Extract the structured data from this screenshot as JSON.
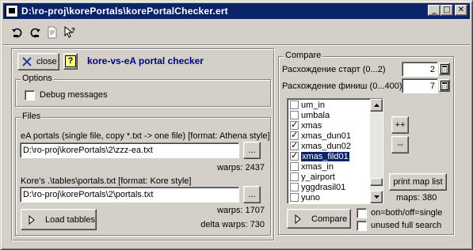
{
  "window": {
    "title": "D:\\ro-proj\\korePortals\\korePortalChecker.ert",
    "minimize": "_",
    "maximize": "□",
    "close": "✕"
  },
  "toolbar": {
    "icons": [
      "undo-arrow-icon",
      "redo-arrow-icon",
      "page-icon",
      "context-help-icon"
    ]
  },
  "header": {
    "close_label": "close",
    "help_label": "?",
    "app_title": "kore-vs-eA portal checker",
    "title_color": "#000080"
  },
  "options": {
    "legend": "Options",
    "debug_label": "Debug messages",
    "debug_checked": false
  },
  "files": {
    "legend": "Files",
    "ea_label": "eA portals (single file, copy *.txt -> one file) [format: Athena style]",
    "ea_path": "D:\\ro-proj\\korePortals\\2\\zzz-ea.txt",
    "ea_browse": "...",
    "ea_warps": "warps: 2437",
    "kore_label": "Kore's .\\tables\\portals.txt [format: Kore style]",
    "kore_path": "D:\\ro-proj\\korePortals\\2\\portals.txt",
    "kore_browse": "...",
    "kore_warps": "warps: 1707",
    "delta_warps": "delta warps: 730",
    "load_label": "Load tabbles"
  },
  "compare": {
    "legend": "Compare",
    "start_label": "Расхождение старт (0...2)",
    "start_value": "2",
    "finish_label": "Расхождение финиш (0...400)",
    "finish_value": "7",
    "maps": [
      {
        "name": "um_in",
        "checked": false,
        "selected": false
      },
      {
        "name": "umbala",
        "checked": false,
        "selected": false
      },
      {
        "name": "xmas",
        "checked": true,
        "selected": false
      },
      {
        "name": "xmas_dun01",
        "checked": true,
        "selected": false
      },
      {
        "name": "xmas_dun02",
        "checked": true,
        "selected": false
      },
      {
        "name": "xmas_fild01",
        "checked": true,
        "selected": true
      },
      {
        "name": "xmas_in",
        "checked": false,
        "selected": false
      },
      {
        "name": "y_airport",
        "checked": false,
        "selected": false
      },
      {
        "name": "yggdrasil01",
        "checked": false,
        "selected": false
      },
      {
        "name": "yuno",
        "checked": false,
        "selected": false
      }
    ],
    "plus_label": "++",
    "minus_label": "--",
    "print_label": "print map list",
    "maps_count": "maps: 380",
    "compare_label": "Compare",
    "onboth_label": "on=both/off=single",
    "onboth_checked": false,
    "unused_label": "unused full search",
    "unused_checked": false
  }
}
